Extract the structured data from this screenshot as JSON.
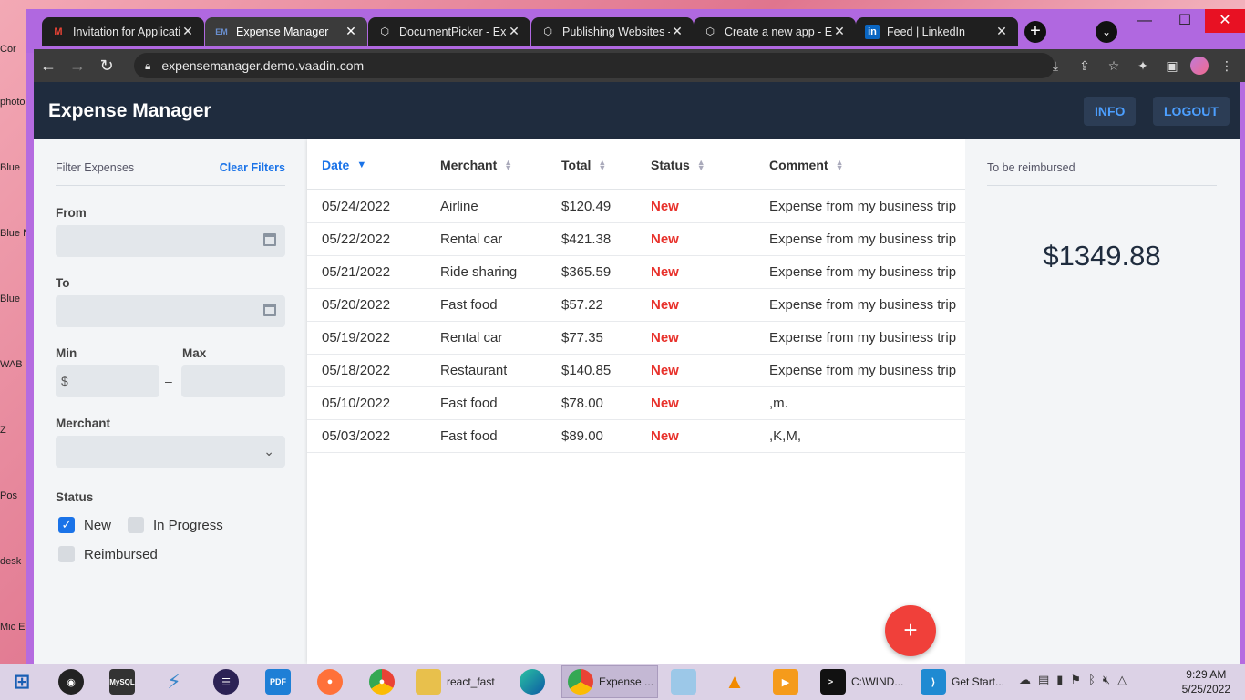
{
  "desktop": {
    "labels": [
      "Cor",
      "photo",
      "Blue",
      "Blue Mult",
      "Blue",
      "WAB",
      "Z",
      "Pos",
      "desk",
      "Mic E"
    ]
  },
  "browser": {
    "tabs": [
      {
        "icon": "gmail-icon",
        "label": "Invitation for Applicati"
      },
      {
        "icon": "vaadin-icon",
        "label": "Expense Manager",
        "active": true
      },
      {
        "icon": "expo-icon",
        "label": "DocumentPicker - Exp"
      },
      {
        "icon": "expo-icon",
        "label": "Publishing Websites -"
      },
      {
        "icon": "expo-icon",
        "label": "Create a new app - Ex"
      },
      {
        "icon": "linkedin-icon",
        "label": "Feed | LinkedIn"
      }
    ],
    "url": "expensemanager.demo.vaadin.com"
  },
  "app": {
    "title": "Expense Manager",
    "info_label": "INFO",
    "logout_label": "LOGOUT",
    "accent": "#1a73e8",
    "status_color": "#e8322c"
  },
  "filters": {
    "heading": "Filter Expenses",
    "clear_label": "Clear Filters",
    "from_label": "From",
    "to_label": "To",
    "min_label": "Min",
    "max_label": "Max",
    "min_prefix": "$",
    "range_dash": "–",
    "merchant_label": "Merchant",
    "status_label": "Status",
    "statuses": [
      {
        "label": "New",
        "checked": true
      },
      {
        "label": "In Progress",
        "checked": false
      },
      {
        "label": "Reimbursed",
        "checked": false
      }
    ]
  },
  "grid": {
    "columns": [
      "Date",
      "Merchant",
      "Total",
      "Status",
      "Comment"
    ],
    "sorted_column": "Date",
    "rows": [
      {
        "date": "05/24/2022",
        "merchant": "Airline",
        "total": "$120.49",
        "status": "New",
        "comment": "Expense from my business trip"
      },
      {
        "date": "05/22/2022",
        "merchant": "Rental car",
        "total": "$421.38",
        "status": "New",
        "comment": "Expense from my business trip"
      },
      {
        "date": "05/21/2022",
        "merchant": "Ride sharing",
        "total": "$365.59",
        "status": "New",
        "comment": "Expense from my business trip"
      },
      {
        "date": "05/20/2022",
        "merchant": "Fast food",
        "total": "$57.22",
        "status": "New",
        "comment": "Expense from my business trip"
      },
      {
        "date": "05/19/2022",
        "merchant": "Rental car",
        "total": "$77.35",
        "status": "New",
        "comment": "Expense from my business trip"
      },
      {
        "date": "05/18/2022",
        "merchant": "Restaurant",
        "total": "$140.85",
        "status": "New",
        "comment": "Expense from my business trip"
      },
      {
        "date": "05/10/2022",
        "merchant": "Fast food",
        "total": "$78.00",
        "status": "New",
        "comment": ",m."
      },
      {
        "date": "05/03/2022",
        "merchant": "Fast food",
        "total": "$89.00",
        "status": "New",
        "comment": ",K,M,"
      }
    ],
    "fab_label": "+"
  },
  "summary": {
    "label": "To be reimbursed",
    "amount": "$1349.88"
  },
  "taskbar": {
    "items": [
      {
        "icon": "windows-start-icon"
      },
      {
        "icon": "webcam-icon"
      },
      {
        "icon": "mysql-icon",
        "text": "MySQL"
      },
      {
        "icon": "bolt-app-icon"
      },
      {
        "icon": "eclipse-icon"
      },
      {
        "icon": "pdf-icon",
        "text": "PDF"
      },
      {
        "icon": "firefox-icon"
      },
      {
        "icon": "chrome-icon"
      },
      {
        "icon": "folder-icon",
        "label": "react_fast"
      },
      {
        "icon": "edge-icon"
      },
      {
        "icon": "chrome-icon",
        "label": "Expense ...",
        "active": true
      },
      {
        "icon": "notepad-icon"
      },
      {
        "icon": "vlc-icon"
      },
      {
        "icon": "media-player-icon"
      },
      {
        "icon": "cmd-icon",
        "label": "C:\\WIND..."
      },
      {
        "icon": "vscode-icon",
        "label": "Get Start..."
      }
    ],
    "time": "9:29 AM",
    "date": "5/25/2022"
  }
}
